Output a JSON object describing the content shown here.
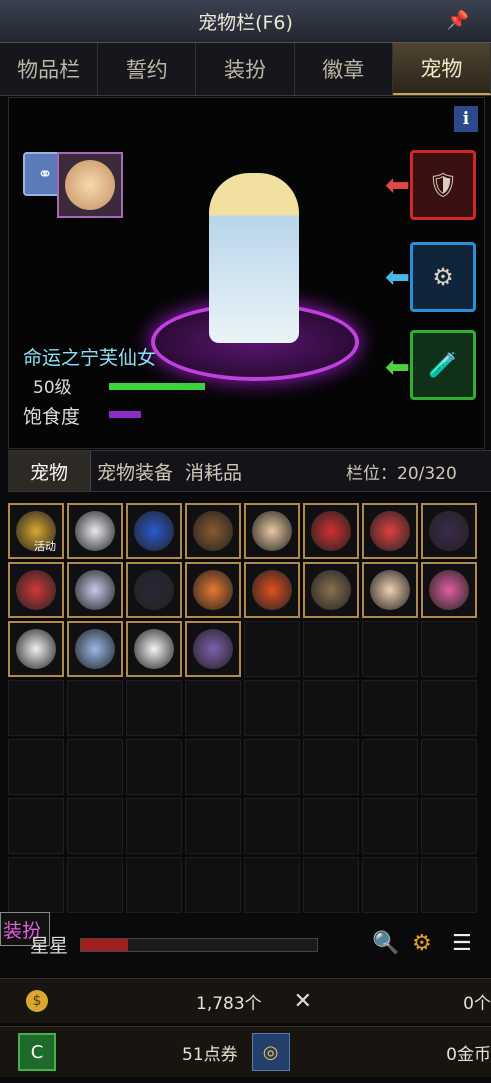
{
  "window": {
    "title": "宠物栏(F6)"
  },
  "tabs": [
    "物品栏",
    "誓约",
    "装扮",
    "徽章",
    "宠物"
  ],
  "active_tab": "宠物",
  "pet": {
    "name": "命运之宁芙仙女",
    "level_label": "50级",
    "level_fill": 1.0,
    "hunger_label": "饱食度",
    "hunger_fill": 0.33
  },
  "subtabs": [
    "宠物",
    "宠物装备",
    "消耗品"
  ],
  "capacity": "栏位：20/320",
  "inventory": {
    "filled": 20,
    "total_cells": 56,
    "overlay_label": "活动"
  },
  "footer": {
    "left_badge": "装扮",
    "star_label": "星星",
    "star_fill": 0.2,
    "coins": "1,783个",
    "coins_right": "0个",
    "points": "51点券",
    "gold": "0金币"
  },
  "colors": {
    "accent": "#c9a55a",
    "level_bar": "#3cd23c",
    "hunger_bar": "#8c2cc8"
  }
}
